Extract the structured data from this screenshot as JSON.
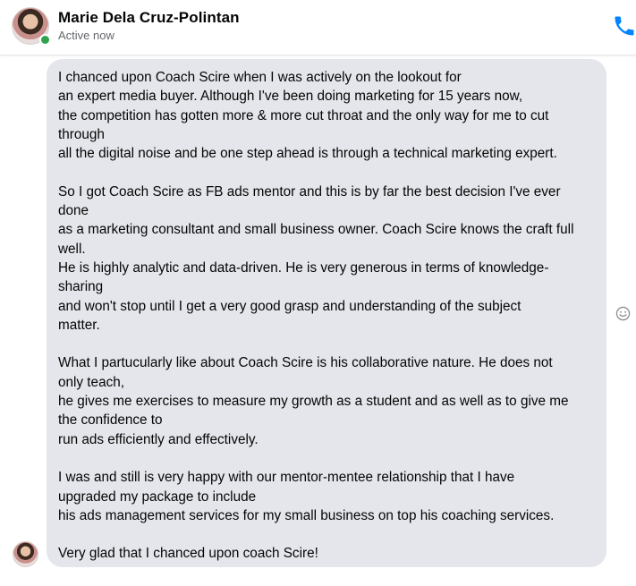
{
  "header": {
    "contact_name": "Marie Dela Cruz-Polintan",
    "status": "Active now",
    "call_icon": "phone-icon"
  },
  "colors": {
    "bubble_bg": "#e4e6eb",
    "active_status": "#31a24c",
    "call_icon": "#0084ff",
    "secondary_text": "#65676b"
  },
  "message": {
    "paragraphs": [
      "I chanced upon Coach Scire when I was actively on the lookout for\nan expert media buyer. Although I've been doing marketing for 15 years now,\nthe competition has gotten more & more cut throat and the only way for me to cut\nthrough\nall the digital noise and be one step ahead is through a technical marketing expert.",
      "So I got Coach Scire as FB ads mentor and this is by far the best decision I've ever\ndone\nas a marketing consultant and small business owner. Coach Scire knows the craft full\nwell.\nHe is highly analytic and data-driven. He is very generous in terms of knowledge-\nsharing\nand won't stop until I get a very good grasp and understanding of the subject\nmatter.",
      "What I partucularly like about Coach Scire is his collaborative nature. He does not\nonly teach,\nhe gives me exercises to measure my growth as a student and as well as to give me\nthe confidence to\nrun ads efficiently and effectively.",
      "I was and still is very happy with our mentor-mentee relationship that I have\nupgraded my package to include\nhis ads management services for my small business on top his coaching services.",
      "Very glad that I chanced upon coach Scire!"
    ],
    "reaction_icon": "smiley-face-icon"
  }
}
